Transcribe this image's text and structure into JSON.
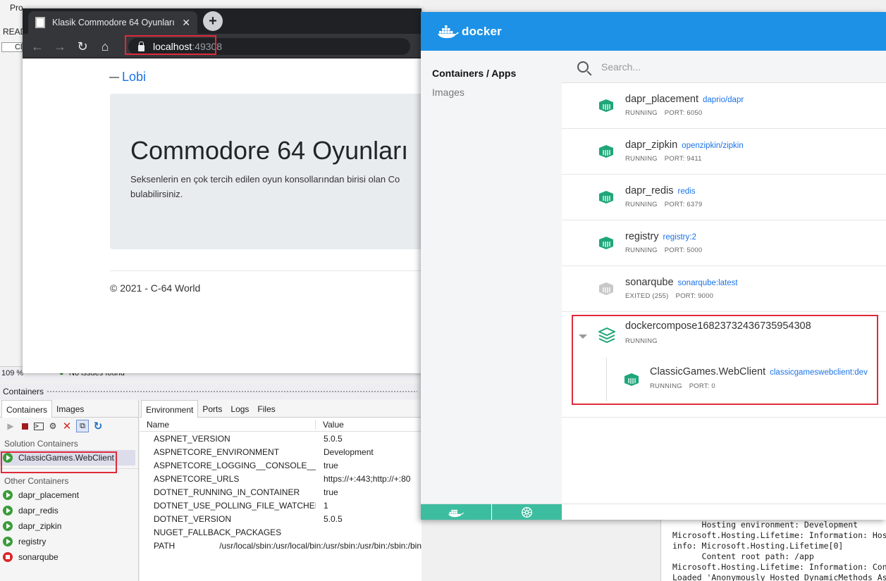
{
  "vs": {
    "top_fragments": {
      "menu_fragment": "Pro",
      "readme_fragment": "READ",
      "file_tab_fragment": "Cl"
    },
    "zoom": "109 %",
    "issues": "No issues found",
    "panel_title": "Containers",
    "left_tabs": [
      "Containers",
      "Images"
    ],
    "solution_section": "Solution Containers",
    "solution_items": [
      {
        "name": "ClassicGames.WebClient",
        "state": "running"
      }
    ],
    "other_section": "Other Containers",
    "other_items": [
      {
        "name": "dapr_placement",
        "state": "running"
      },
      {
        "name": "dapr_redis",
        "state": "running"
      },
      {
        "name": "dapr_zipkin",
        "state": "running"
      },
      {
        "name": "registry",
        "state": "running"
      },
      {
        "name": "sonarqube",
        "state": "stopped"
      }
    ],
    "right_tabs": [
      "Environment",
      "Ports",
      "Logs",
      "Files"
    ],
    "env_headers": {
      "name": "Name",
      "value": "Value"
    },
    "env_rows": [
      {
        "name": "ASPNET_VERSION",
        "value": "5.0.5"
      },
      {
        "name": "ASPNETCORE_ENVIRONMENT",
        "value": "Development"
      },
      {
        "name": "ASPNETCORE_LOGGING__CONSOLE__DISA...",
        "value": "true"
      },
      {
        "name": "ASPNETCORE_URLS",
        "value": "https://+:443;http://+:80"
      },
      {
        "name": "DOTNET_RUNNING_IN_CONTAINER",
        "value": "true"
      },
      {
        "name": "DOTNET_USE_POLLING_FILE_WATCHER",
        "value": "1"
      },
      {
        "name": "DOTNET_VERSION",
        "value": "5.0.5"
      },
      {
        "name": "NUGET_FALLBACK_PACKAGES",
        "value": ""
      },
      {
        "name": "PATH",
        "value": "/usr/local/sbin:/usr/local/bin:/usr/sbin:/usr/bin:/sbin:/bin"
      }
    ],
    "output_lines": [
      "      Hosting environment: Development",
      "Microsoft.Hosting.Lifetime: Information: Hos",
      "info: Microsoft.Hosting.Lifetime[0]",
      "      Content root path: /app",
      "Microsoft.Hosting.Lifetime: Information: Con",
      "Loaded 'Anonymously Hosted DynamicMethods As"
    ]
  },
  "browser": {
    "tab_title": "Klasik Commodore 64 Oyunları -",
    "url_host": "localhost",
    "url_port": ":49308",
    "nav_link": "Lobi",
    "heading": "Commodore 64 Oyunları",
    "lead_line1": "Seksenlerin en çok tercih edilen oyun konsollarından birisi olan Co",
    "lead_line2": "bulabilirsiniz.",
    "footer": "© 2021 - C-64 World"
  },
  "docker": {
    "brand": "docker",
    "nav": {
      "containers": "Containers / Apps",
      "images": "Images"
    },
    "search_placeholder": "Search...",
    "containers": [
      {
        "name": "dapr_placement",
        "image": "daprio/dapr",
        "status": "RUNNING",
        "port": "PORT: 6050",
        "running": true
      },
      {
        "name": "dapr_zipkin",
        "image": "openzipkin/zipkin",
        "status": "RUNNING",
        "port": "PORT: 9411",
        "running": true
      },
      {
        "name": "dapr_redis",
        "image": "redis",
        "status": "RUNNING",
        "port": "PORT: 6379",
        "running": true
      },
      {
        "name": "registry",
        "image": "registry:2",
        "status": "RUNNING",
        "port": "PORT: 5000",
        "running": true
      },
      {
        "name": "sonarqube",
        "image": "sonarqube:latest",
        "status": "EXITED (255)",
        "port": "PORT: 9000",
        "running": false
      }
    ],
    "compose": {
      "name": "dockercompose16823732436735954308",
      "status": "RUNNING",
      "child": {
        "name": "ClassicGames.WebClient",
        "image": "classicgameswebclient:dev",
        "status": "RUNNING",
        "port": "PORT: 0"
      }
    },
    "colors": {
      "header": "#1d91e6",
      "running": "#1fa67a",
      "exited": "#c8c8c8",
      "link": "#1a73e8",
      "bottom": "#3dbd9f",
      "highlight": "#e02a3a"
    }
  }
}
